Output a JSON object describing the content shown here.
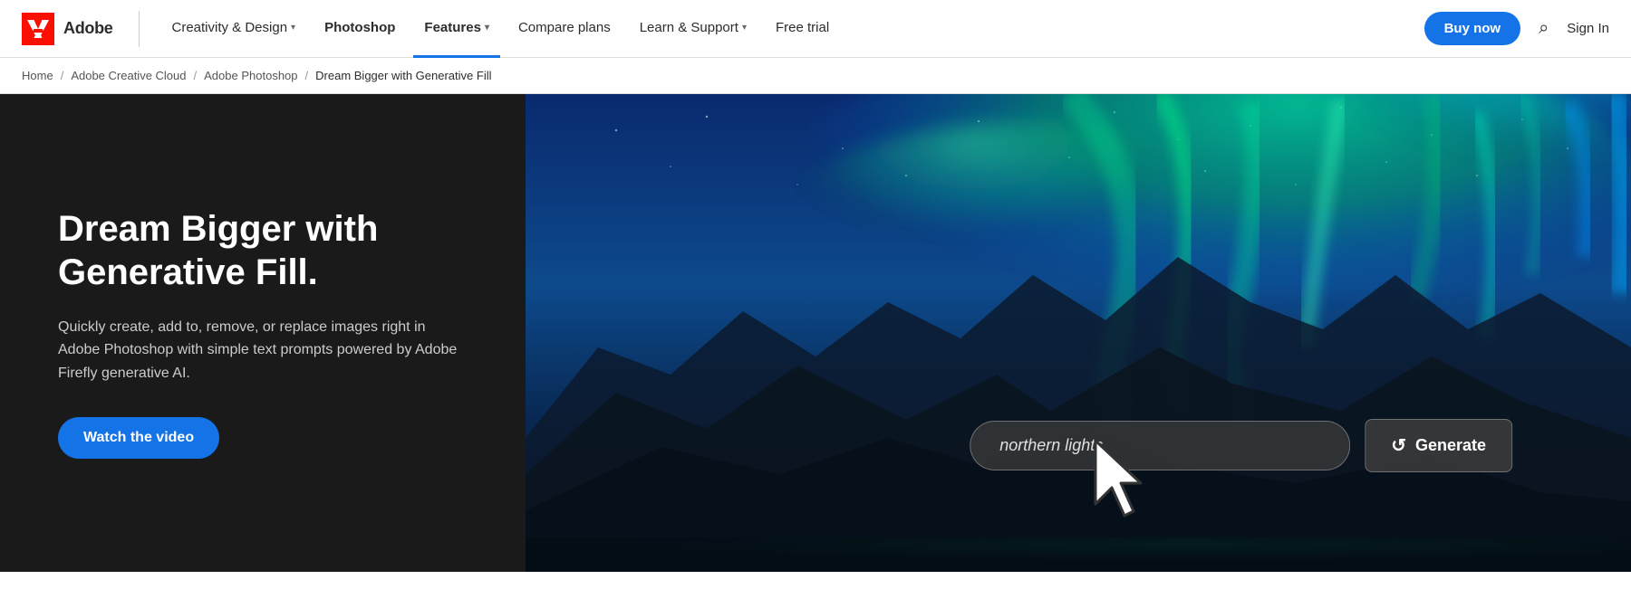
{
  "nav": {
    "logo_text": "Adobe",
    "items": [
      {
        "label": "Creativity & Design",
        "has_chevron": true,
        "active": false
      },
      {
        "label": "Photoshop",
        "has_chevron": false,
        "active": false
      },
      {
        "label": "Features",
        "has_chevron": true,
        "active": true
      },
      {
        "label": "Compare plans",
        "has_chevron": false,
        "active": false
      },
      {
        "label": "Learn & Support",
        "has_chevron": true,
        "active": false
      },
      {
        "label": "Free trial",
        "has_chevron": false,
        "active": false
      }
    ],
    "buy_label": "Buy now",
    "signin_label": "Sign In"
  },
  "breadcrumb": {
    "items": [
      {
        "label": "Home",
        "href": "#"
      },
      {
        "label": "Adobe Creative Cloud",
        "href": "#"
      },
      {
        "label": "Adobe Photoshop",
        "href": "#"
      },
      {
        "label": "Dream Bigger with Generative Fill",
        "href": null
      }
    ]
  },
  "hero": {
    "title": "Dream Bigger with Generative Fill.",
    "description": "Quickly create, add to, remove, or replace images right in Adobe Photoshop with simple text prompts powered by Adobe Firefly generative AI.",
    "cta_label": "Watch the video",
    "input_placeholder": "northern lights",
    "input_value": "northern lights",
    "generate_label": "Generate"
  }
}
